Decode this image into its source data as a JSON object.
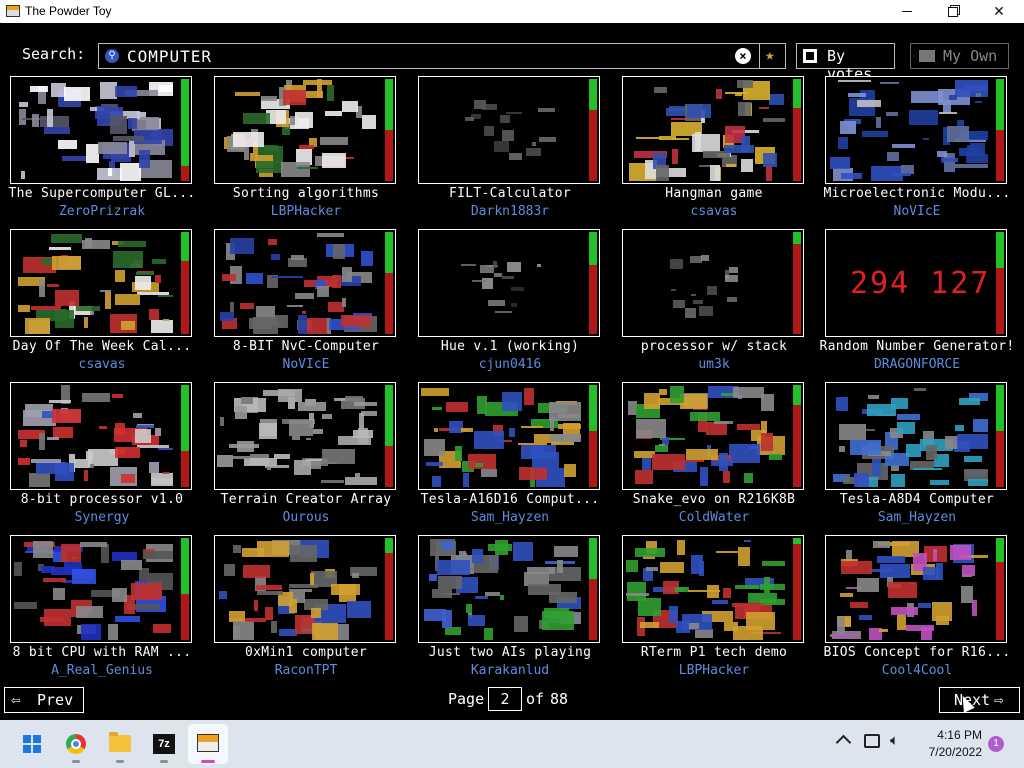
{
  "window": {
    "title": "The Powder Toy"
  },
  "search": {
    "label": "Search:",
    "query": "COMPUTER"
  },
  "toolbar": {
    "sort_label": "By votes",
    "own_label": "My Own"
  },
  "saves": [
    {
      "title": "The Supercomputer GL...",
      "author": "ZeroPrizrak",
      "score": 0.85
    },
    {
      "title": "Sorting algorithms",
      "author": "LBPHacker",
      "score": 0.5
    },
    {
      "title": "FILT-Calculator",
      "author": "Darkn1883r",
      "score": 0.3
    },
    {
      "title": "Hangman game",
      "author": "csavas",
      "score": 0.28
    },
    {
      "title": "Microelectronic Modu...",
      "author": "NoVIcE",
      "score": 0.5
    },
    {
      "title": "Day Of The Week Cal...",
      "author": "csavas",
      "score": 0.28
    },
    {
      "title": "8-BIT NvC-Computer",
      "author": "NoVIcE",
      "score": 0.4
    },
    {
      "title": "Hue v.1 (working)",
      "author": "cjun0416",
      "score": 0.32
    },
    {
      "title": "processor w/ stack",
      "author": "um3k",
      "score": 0.12
    },
    {
      "title": "Random Number Generator!",
      "author": "DRAGONFORCE",
      "score": 0.35
    },
    {
      "title": "8-bit processor v1.0",
      "author": "Synergy",
      "score": 0.65
    },
    {
      "title": "Terrain Creator Array",
      "author": "Ourous",
      "score": 0.6
    },
    {
      "title": "Tesla-A16D16 Comput...",
      "author": "Sam_Hayzen",
      "score": 0.45
    },
    {
      "title": "Snake_evo on R216K8B",
      "author": "ColdWater",
      "score": 0.2
    },
    {
      "title": "Tesla-A8D4 Computer",
      "author": "Sam_Hayzen",
      "score": 0.45
    },
    {
      "title": "8 bit CPU with RAM ...",
      "author": "A_Real_Genius",
      "score": 0.55
    },
    {
      "title": "0xMin1 computer",
      "author": "RaconTPT",
      "score": 0.15
    },
    {
      "title": "Just two AIs playing",
      "author": "Karakanlud",
      "score": 0.4
    },
    {
      "title": "RTerm P1 tech demo",
      "author": "LBPHacker",
      "score": 0.06
    },
    {
      "title": "BIOS Concept for R16...",
      "author": "Cool4Cool",
      "score": 0.24
    }
  ],
  "thumb_styles": [
    "computer",
    "sorting",
    "sparse",
    "hangman",
    "micro",
    "dayweek",
    "nvc",
    "hue",
    "stack",
    "rng",
    "proc8",
    "terrain",
    "tesla16",
    "snake",
    "tesla8",
    "cpu8",
    "oxmin",
    "aiplay",
    "rterm",
    "bios"
  ],
  "rng_display": "294 127",
  "pagination": {
    "prev_label": "Prev",
    "next_label": "Next",
    "page_label": "Page",
    "current_page": "2",
    "of_label": "of",
    "total_pages": "88"
  },
  "taskbar": {
    "time": "4:16 PM",
    "date": "7/20/2022",
    "notification_count": "1",
    "app_7zip": "7z",
    "icons": [
      "windows-start-icon",
      "chrome-icon",
      "file-explorer-icon",
      "7zip-icon",
      "powder-toy-icon"
    ]
  },
  "colors": {
    "background": "#000000",
    "author_link": "#5b8ee0",
    "vote_up": "#22c028",
    "vote_down": "#b01818",
    "taskbar": "#dde4ee"
  }
}
